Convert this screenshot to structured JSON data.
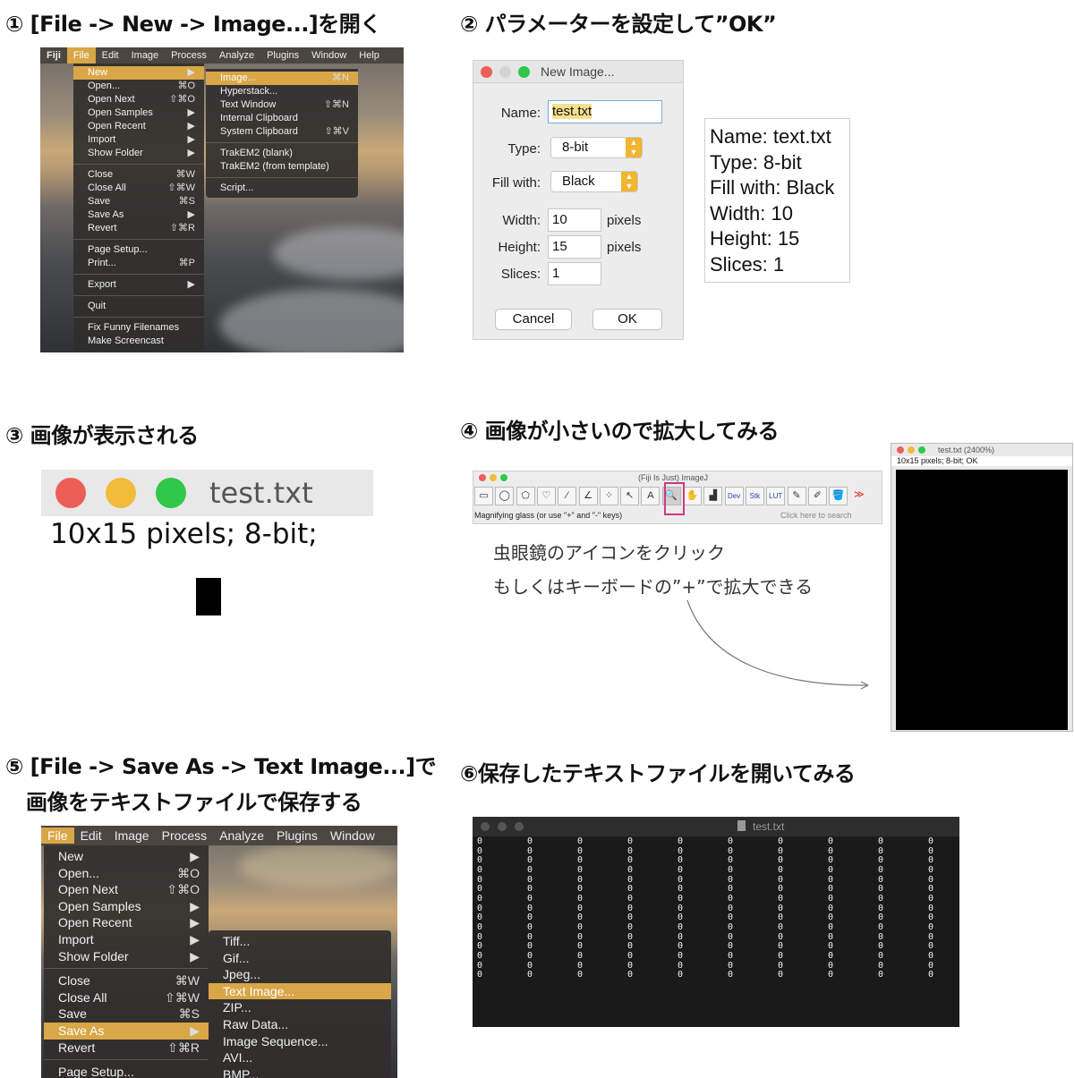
{
  "steps": {
    "s1": "① [File -> New -> Image...]を開く",
    "s2": "② パラメーターを設定して”OK”",
    "s3": "③ 画像が表示される",
    "s4": "④ 画像が小さいので拡大してみる",
    "s5a": "⑤ [File -> Save As -> Text Image...]で",
    "s5b": "画像をテキストファイルで保存する",
    "s6": "⑥保存したテキストファイルを開いてみる"
  },
  "menubar1": [
    "Fiji",
    "File",
    "Edit",
    "Image",
    "Process",
    "Analyze",
    "Plugins",
    "Window",
    "Help"
  ],
  "file_menu1": [
    {
      "label": "New",
      "sc": "▶",
      "hl": true
    },
    {
      "label": "Open...",
      "sc": "⌘O"
    },
    {
      "label": "Open Next",
      "sc": "⇧⌘O"
    },
    {
      "label": "Open Samples",
      "sc": "▶"
    },
    {
      "label": "Open Recent",
      "sc": "▶"
    },
    {
      "label": "Import",
      "sc": "▶"
    },
    {
      "label": "Show Folder",
      "sc": "▶"
    },
    {
      "sep": true
    },
    {
      "label": "Close",
      "sc": "⌘W"
    },
    {
      "label": "Close All",
      "sc": "⇧⌘W"
    },
    {
      "label": "Save",
      "sc": "⌘S"
    },
    {
      "label": "Save As",
      "sc": "▶"
    },
    {
      "label": "Revert",
      "sc": "⇧⌘R"
    },
    {
      "sep": true
    },
    {
      "label": "Page Setup...",
      "sc": ""
    },
    {
      "label": "Print...",
      "sc": "⌘P"
    },
    {
      "sep": true
    },
    {
      "label": "Export",
      "sc": "▶"
    },
    {
      "sep": true
    },
    {
      "label": "Quit",
      "sc": ""
    },
    {
      "sep": true
    },
    {
      "label": "Fix Funny Filenames",
      "sc": ""
    },
    {
      "label": "Make Screencast",
      "sc": ""
    }
  ],
  "new_submenu": [
    {
      "label": "Image...",
      "sc": "⌘N",
      "hl": true
    },
    {
      "label": "Hyperstack...",
      "sc": ""
    },
    {
      "label": "Text Window",
      "sc": "⇧⌘N"
    },
    {
      "label": "Internal Clipboard",
      "sc": ""
    },
    {
      "label": "System Clipboard",
      "sc": "⇧⌘V"
    },
    {
      "sep": true
    },
    {
      "label": "TrakEM2 (blank)",
      "sc": ""
    },
    {
      "label": "TrakEM2 (from template)",
      "sc": ""
    },
    {
      "sep": true
    },
    {
      "label": "Script...",
      "sc": ""
    }
  ],
  "dialog": {
    "title": "New Image...",
    "name_label": "Name:",
    "name_value": "test.txt",
    "type_label": "Type:",
    "type_value": "8-bit",
    "fill_label": "Fill with:",
    "fill_value": "Black",
    "width_label": "Width:",
    "width_value": "10",
    "height_label": "Height:",
    "height_value": "15",
    "slices_label": "Slices:",
    "slices_value": "1",
    "unit": "pixels",
    "cancel": "Cancel",
    "ok": "OK"
  },
  "infobox": [
    "Name: text.txt",
    "Type: 8-bit",
    "Fill with: Black",
    "Width: 10",
    "Height: 15",
    "Slices: 1"
  ],
  "imgwin": {
    "title": "test.txt",
    "info": "10x15 pixels; 8-bit;"
  },
  "toolbar": {
    "title": "(Fiji Is Just) ImageJ",
    "status": "Magnifying glass (or use \"+\" and \"-\" keys)",
    "search": "Click here to search",
    "tools": [
      "▭",
      "◯",
      "⬠",
      "♡",
      "∕",
      "∠",
      "⁘",
      "↖",
      "A",
      "🔍",
      "✋",
      "▟",
      "Dev",
      "Stk",
      "LUT",
      "✎",
      "✐",
      "🪣",
      "≫"
    ]
  },
  "zoom_note": [
    "虫眼鏡のアイコンをクリック",
    "もしくはキーボードの”+”で拡大できる"
  ],
  "zoomwin": {
    "title": "test.txt (2400%)",
    "info": "10x15 pixels; 8-bit; OK"
  },
  "menubar2": [
    "File",
    "Edit",
    "Image",
    "Process",
    "Analyze",
    "Plugins",
    "Window"
  ],
  "file_menu2": [
    {
      "label": "New",
      "sc": "▶"
    },
    {
      "label": "Open...",
      "sc": "⌘O"
    },
    {
      "label": "Open Next",
      "sc": "⇧⌘O"
    },
    {
      "label": "Open Samples",
      "sc": "▶"
    },
    {
      "label": "Open Recent",
      "sc": "▶"
    },
    {
      "label": "Import",
      "sc": "▶"
    },
    {
      "label": "Show Folder",
      "sc": "▶"
    },
    {
      "sep": true
    },
    {
      "label": "Close",
      "sc": "⌘W"
    },
    {
      "label": "Close All",
      "sc": "⇧⌘W"
    },
    {
      "label": "Save",
      "sc": "⌘S"
    },
    {
      "label": "Save As",
      "sc": "▶",
      "hl": true
    },
    {
      "label": "Revert",
      "sc": "⇧⌘R"
    },
    {
      "sep": true
    },
    {
      "label": "Page Setup...",
      "sc": ""
    }
  ],
  "saveas_submenu": [
    {
      "label": "Tiff...",
      "sc": ""
    },
    {
      "label": "Gif...",
      "sc": ""
    },
    {
      "label": "Jpeg...",
      "sc": ""
    },
    {
      "label": "Text Image...",
      "sc": "",
      "hl": true
    },
    {
      "label": "ZIP...",
      "sc": ""
    },
    {
      "label": "Raw Data...",
      "sc": ""
    },
    {
      "label": "Image Sequence...",
      "sc": ""
    },
    {
      "label": "AVI...",
      "sc": ""
    },
    {
      "label": "BMP...",
      "sc": ""
    }
  ],
  "textfile": {
    "title": "test.txt",
    "value": "0",
    "cols": 10,
    "rows": 15
  },
  "colors": {
    "accent": "#d9a648",
    "highlight_box": "#cc3a84",
    "tl_red": "#ec5f58",
    "tl_yellow": "#f1bb3b",
    "tl_green": "#2fc84a"
  }
}
